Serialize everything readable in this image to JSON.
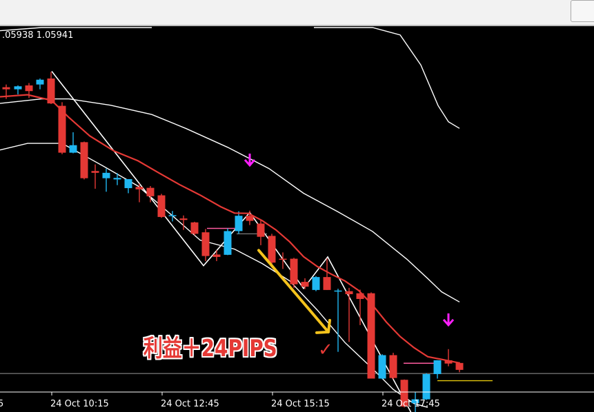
{
  "window": {
    "title": ""
  },
  "chart_data": {
    "type": "candlestick",
    "title": "",
    "quote_readout": ".05938 1.05941",
    "annotation_profit": "利益＋24PIPS",
    "annotation_check": "✓",
    "x_tick_labels": [
      "5",
      "24 Oct 10:15",
      "24 Oct 12:45",
      "24 Oct 15:15",
      "24 Oct 17:45"
    ],
    "colors": {
      "background": "#000000",
      "bull_candle": "#1fb7f2",
      "bear_candle": "#e53935",
      "moving_average": "#e53935",
      "bands": "#ffffff",
      "zigzag": "#ffffff",
      "signal_arrow": "#ff1fff",
      "trend_arrow": "#f5c31c",
      "pink_level": "#ff5ca0",
      "yellow_level": "#e5c80c",
      "gray_level": "#9a9a9a"
    },
    "ylim": [
      0,
      100
    ],
    "candles": [
      {
        "x": 9,
        "o": 67.3,
        "h": 68.2,
        "l": 63.4,
        "c": 66.6
      },
      {
        "x": 26,
        "o": 66.6,
        "h": 67.9,
        "l": 64.9,
        "c": 67.6
      },
      {
        "x": 42,
        "o": 67.9,
        "h": 68.7,
        "l": 63.7,
        "c": 66.0
      },
      {
        "x": 58,
        "o": 68.2,
        "h": 70.2,
        "l": 66.6,
        "c": 69.8
      },
      {
        "x": 74,
        "o": 70.2,
        "h": 72.4,
        "l": 61.7,
        "c": 61.9
      },
      {
        "x": 90,
        "o": 61.1,
        "h": 62.3,
        "l": 45.0,
        "c": 45.5
      },
      {
        "x": 106,
        "o": 45.5,
        "h": 52.3,
        "l": 45.3,
        "c": 48.0
      },
      {
        "x": 122,
        "o": 49.0,
        "h": 49.2,
        "l": 36.6,
        "c": 37.0
      },
      {
        "x": 138,
        "o": 39.4,
        "h": 41.6,
        "l": 33.5,
        "c": 38.8
      },
      {
        "x": 154,
        "o": 37.0,
        "h": 40.2,
        "l": 32.5,
        "c": 38.8
      },
      {
        "x": 170,
        "o": 36.6,
        "h": 38.7,
        "l": 34.7,
        "c": 37.1
      },
      {
        "x": 186,
        "o": 33.7,
        "h": 35.8,
        "l": 32.0,
        "c": 36.7
      },
      {
        "x": 202,
        "o": 34.1,
        "h": 35.2,
        "l": 29.0,
        "c": 33.3
      },
      {
        "x": 218,
        "o": 33.8,
        "h": 34.4,
        "l": 29.0,
        "c": 31.0
      },
      {
        "x": 234,
        "o": 31.3,
        "h": 31.8,
        "l": 23.8,
        "c": 24.1
      },
      {
        "x": 250,
        "o": 24.7,
        "h": 26.1,
        "l": 22.6,
        "c": 24.7
      },
      {
        "x": 266,
        "o": 23.6,
        "h": 24.6,
        "l": 19.8,
        "c": 23.1
      },
      {
        "x": 282,
        "o": 22.3,
        "h": 22.5,
        "l": 18.0,
        "c": 18.5
      },
      {
        "x": 298,
        "o": 19.0,
        "h": 20.1,
        "l": 9.4,
        "c": 11.1
      },
      {
        "x": 314,
        "o": 11.6,
        "h": 13.0,
        "l": 9.4,
        "c": 10.8
      },
      {
        "x": 330,
        "o": 11.5,
        "h": 20.3,
        "l": 11.4,
        "c": 19.4
      },
      {
        "x": 346,
        "o": 19.4,
        "h": 26.0,
        "l": 18.5,
        "c": 24.5
      },
      {
        "x": 362,
        "o": 24.5,
        "h": 26.2,
        "l": 21.4,
        "c": 22.8
      },
      {
        "x": 378,
        "o": 21.9,
        "h": 23.0,
        "l": 14.7,
        "c": 17.5
      },
      {
        "x": 394,
        "o": 17.8,
        "h": 18.5,
        "l": 8.5,
        "c": 8.9
      },
      {
        "x": 410,
        "o": 10.2,
        "h": 12.3,
        "l": 6.8,
        "c": 9.9
      },
      {
        "x": 426,
        "o": 10.2,
        "h": 10.5,
        "l": 0.5,
        "c": 1.7
      },
      {
        "x": 442,
        "o": 2.5,
        "h": 3.7,
        "l": 0.1,
        "c": 0.9
      },
      {
        "x": 458,
        "o": -0.2,
        "h": 4.4,
        "l": -0.6,
        "c": 4.1
      },
      {
        "x": 474,
        "o": 4.1,
        "h": 10.3,
        "l": -0.2,
        "c": -0.2
      },
      {
        "x": 490,
        "o": -0.4,
        "h": 0.2,
        "l": -20.8,
        "c": -0.4
      },
      {
        "x": 506,
        "o": -0.6,
        "h": 0.5,
        "l": -17.5,
        "c": -1.6
      },
      {
        "x": 522,
        "o": -1.3,
        "h": -0.1,
        "l": -11.9,
        "c": -3.2
      },
      {
        "x": 538,
        "o": -1.3,
        "h": -1.0,
        "l": -29.7,
        "c": -29.7
      },
      {
        "x": 554,
        "o": -29.7,
        "h": -21.6,
        "l": -29.9,
        "c": -21.9
      },
      {
        "x": 570,
        "o": -21.9,
        "h": -21.1,
        "l": -29.9,
        "c": -29.5
      },
      {
        "x": 586,
        "o": -30.1,
        "h": -30.0,
        "l": -39.3,
        "c": -39.0
      },
      {
        "x": 602,
        "o": -37.9,
        "h": -34.3,
        "l": -41.5,
        "c": -36.6
      },
      {
        "x": 618,
        "o": -36.6,
        "h": -27.9,
        "l": -36.8,
        "c": -28.2
      },
      {
        "x": 634,
        "o": -28.2,
        "h": -23.6,
        "l": -29.7,
        "c": -23.6
      },
      {
        "x": 650,
        "o": -23.6,
        "h": -19.9,
        "l": -25.6,
        "c": -24.7
      },
      {
        "x": 666,
        "o": -24.5,
        "h": -24.2,
        "l": -27.6,
        "c": -26.8
      }
    ],
    "moving_average": [
      [
        0,
        64.1
      ],
      [
        40,
        64.8
      ],
      [
        75,
        62.9
      ],
      [
        100,
        57.2
      ],
      [
        130,
        51.1
      ],
      [
        165,
        46.1
      ],
      [
        200,
        42.8
      ],
      [
        230,
        38.8
      ],
      [
        260,
        34.9
      ],
      [
        290,
        31.4
      ],
      [
        320,
        27.5
      ],
      [
        340,
        25.4
      ],
      [
        360,
        25.3
      ],
      [
        380,
        22.9
      ],
      [
        400,
        19.8
      ],
      [
        420,
        15.8
      ],
      [
        440,
        10.9
      ],
      [
        460,
        7.6
      ],
      [
        480,
        5.1
      ],
      [
        500,
        2.8
      ],
      [
        520,
        -0.4
      ],
      [
        540,
        -5.2
      ],
      [
        560,
        -10.9
      ],
      [
        580,
        -15.7
      ],
      [
        600,
        -19.4
      ],
      [
        620,
        -22.4
      ],
      [
        640,
        -23.3
      ],
      [
        666,
        -24.5
      ]
    ],
    "band_upper": [
      [
        0,
        86.1
      ],
      [
        60,
        90.5
      ],
      [
        120,
        97.4
      ],
      [
        190,
        100
      ],
      [
        220,
        100
      ]
    ],
    "band_upper2": [
      [
        455,
        100
      ],
      [
        490,
        95.6
      ],
      [
        540,
        92.2
      ],
      [
        580,
        84.7
      ],
      [
        610,
        74.7
      ],
      [
        635,
        61.2
      ],
      [
        650,
        55.8
      ],
      [
        666,
        53.6
      ]
    ],
    "band_middle": [
      [
        0,
        61.9
      ],
      [
        60,
        63.4
      ],
      [
        100,
        63.4
      ],
      [
        160,
        61.3
      ],
      [
        220,
        58.2
      ],
      [
        270,
        53.5
      ],
      [
        330,
        47.3
      ],
      [
        390,
        40.2
      ],
      [
        440,
        32.0
      ],
      [
        490,
        25.8
      ],
      [
        540,
        19.3
      ],
      [
        590,
        10.0
      ],
      [
        620,
        3.6
      ],
      [
        640,
        -0.8
      ],
      [
        666,
        -4.2
      ]
    ],
    "band_lower": [
      [
        0,
        46.4
      ],
      [
        40,
        48.6
      ],
      [
        90,
        48.6
      ],
      [
        150,
        41.0
      ],
      [
        200,
        34.4
      ],
      [
        250,
        24.5
      ],
      [
        290,
        16.4
      ],
      [
        340,
        13.4
      ],
      [
        380,
        8.6
      ],
      [
        420,
        2.8
      ],
      [
        460,
        -6.9
      ],
      [
        500,
        -17.7
      ],
      [
        540,
        -26.4
      ],
      [
        570,
        -33.3
      ],
      [
        600,
        -38.0
      ],
      [
        620,
        -39.3
      ]
    ],
    "zigzag": [
      [
        75,
        72.6
      ],
      [
        295,
        7.9
      ],
      [
        362,
        25.6
      ],
      [
        440,
        0.3
      ],
      [
        475,
        10.8
      ],
      [
        598,
        -41.9
      ]
    ],
    "pink_levels": [
      [
        300,
        343,
        20.3
      ],
      [
        585,
        636,
        -24.6
      ]
    ],
    "gray_levels": [
      [
        343,
        387,
        18.5
      ],
      [
        0,
        861,
        -28.0
      ]
    ],
    "yellow_level": [
      [
        634,
        714,
        -30.4
      ]
    ],
    "signal_arrows": [
      [
        362,
        41.3
      ],
      [
        650,
        -11.9
      ]
    ],
    "trend_arrow": [
      [
        375,
        13.0
      ],
      [
        476,
        -14.2
      ]
    ]
  }
}
